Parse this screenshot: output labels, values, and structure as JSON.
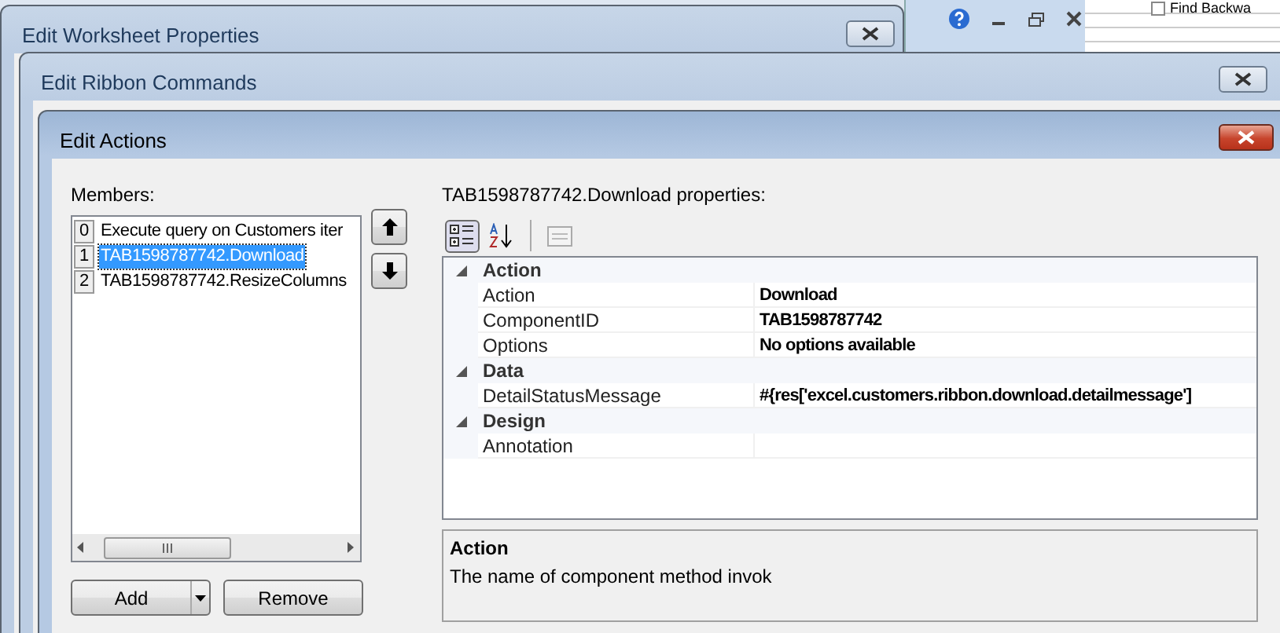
{
  "background": {
    "find_option": {
      "label": "Find Backwa",
      "checked": false
    }
  },
  "windows": [
    {
      "title": "Edit Worksheet Properties"
    },
    {
      "title": "Edit Ribbon Commands"
    }
  ],
  "dialog": {
    "title": "Edit Actions",
    "members_label": "Members:",
    "members": [
      {
        "index": "0",
        "label": "Execute query on Customers iter",
        "selected": false
      },
      {
        "index": "1",
        "label": "TAB1598787742.Download",
        "selected": true
      },
      {
        "index": "2",
        "label": "TAB1598787742.ResizeColumns",
        "selected": false
      }
    ],
    "add_button": "Add",
    "remove_button": "Remove",
    "properties_label": "TAB1598787742.Download properties:",
    "categories": [
      {
        "name": "Action",
        "expanded": true,
        "properties": [
          {
            "name": "Action",
            "value": "Download"
          },
          {
            "name": "ComponentID",
            "value": "TAB1598787742"
          },
          {
            "name": "Options",
            "value": "No options available"
          }
        ]
      },
      {
        "name": "Data",
        "expanded": true,
        "properties": [
          {
            "name": "DetailStatusMessage",
            "value": "#{res['excel.customers.ribbon.download.detailmessage']"
          }
        ]
      },
      {
        "name": "Design",
        "expanded": true,
        "properties": [
          {
            "name": "Annotation"
          }
        ]
      }
    ],
    "description": {
      "title": "Action",
      "text": "The name of component method invok"
    }
  }
}
